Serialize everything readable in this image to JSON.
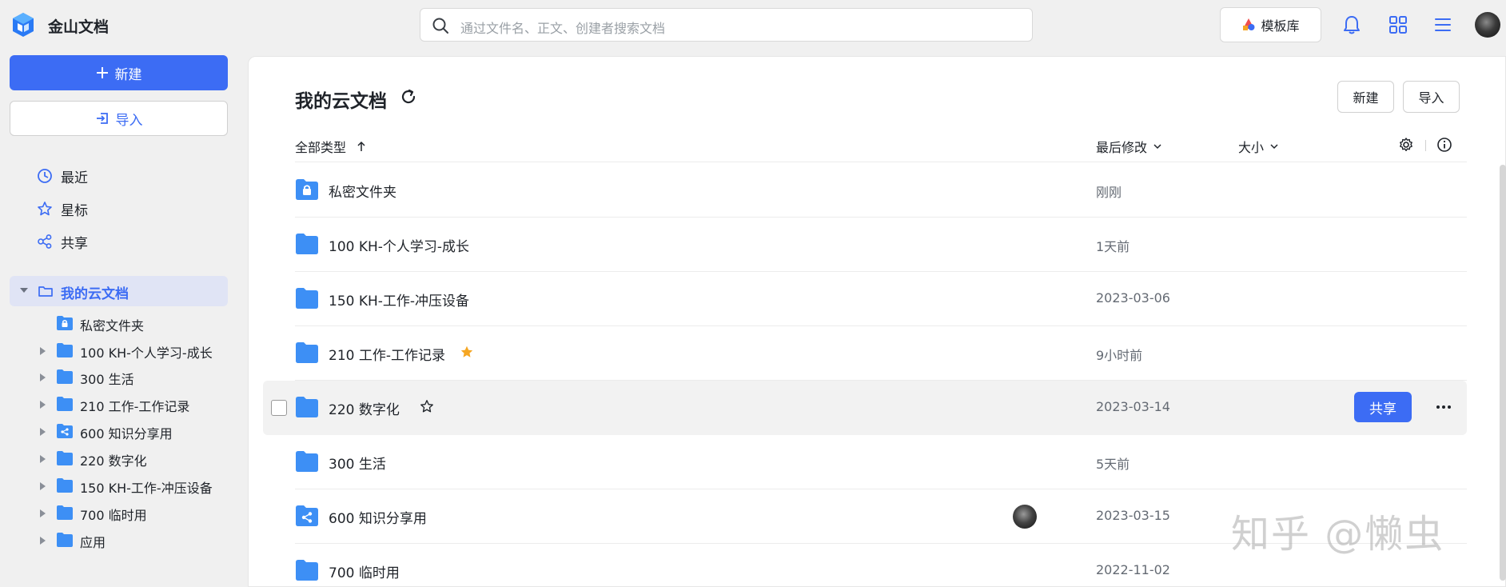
{
  "app": {
    "title": "金山文档"
  },
  "search": {
    "placeholder": "通过文件名、正文、创建者搜索文档"
  },
  "topbar": {
    "template_label": "模板库"
  },
  "sidebar": {
    "new_label": "新建",
    "import_label": "导入",
    "nav": [
      {
        "label": "最近",
        "icon": "clock-icon"
      },
      {
        "label": "星标",
        "icon": "star-icon"
      },
      {
        "label": "共享",
        "icon": "share-icon"
      }
    ],
    "tree_root": "我的云文档",
    "tree": [
      {
        "label": "私密文件夹",
        "icon": "lock-folder-icon"
      },
      {
        "label": "100 KH-个人学习-成长",
        "icon": "folder-icon"
      },
      {
        "label": "300 生活",
        "icon": "folder-icon"
      },
      {
        "label": "210 工作-工作记录",
        "icon": "folder-icon"
      },
      {
        "label": "600 知识分享用",
        "icon": "shared-folder-icon"
      },
      {
        "label": "220 数字化",
        "icon": "folder-icon"
      },
      {
        "label": "150 KH-工作-冲压设备",
        "icon": "folder-icon"
      },
      {
        "label": "700 临时用",
        "icon": "folder-icon"
      },
      {
        "label": "应用",
        "icon": "folder-icon"
      }
    ]
  },
  "main": {
    "title": "我的云文档",
    "new_label": "新建",
    "import_label": "导入",
    "columns": {
      "type": "全部类型",
      "modified": "最后修改",
      "size": "大小"
    },
    "rows": [
      {
        "name": "私密文件夹",
        "modified": "刚刚",
        "icon": "lock-folder-icon"
      },
      {
        "name": "100 KH-个人学习-成长",
        "modified": "1天前",
        "icon": "folder-icon"
      },
      {
        "name": "150 KH-工作-冲压设备",
        "modified": "2023-03-06",
        "icon": "folder-icon"
      },
      {
        "name": "210 工作-工作记录",
        "modified": "9小时前",
        "icon": "folder-icon",
        "starred": true
      },
      {
        "name": "220 数字化",
        "modified": "2023-03-14",
        "icon": "folder-icon",
        "hovered": true,
        "share_label": "共享"
      },
      {
        "name": "300 生活",
        "modified": "5天前",
        "icon": "folder-icon"
      },
      {
        "name": "600 知识分享用",
        "modified": "2023-03-15",
        "icon": "shared-folder-icon"
      },
      {
        "name": "700 临时用",
        "modified": "2022-11-02",
        "icon": "folder-icon"
      }
    ]
  },
  "watermark": "知乎 @懒虫",
  "colors": {
    "accent": "#3c6cf4",
    "folder": "#3d8ff5",
    "star": "#f5a623"
  }
}
